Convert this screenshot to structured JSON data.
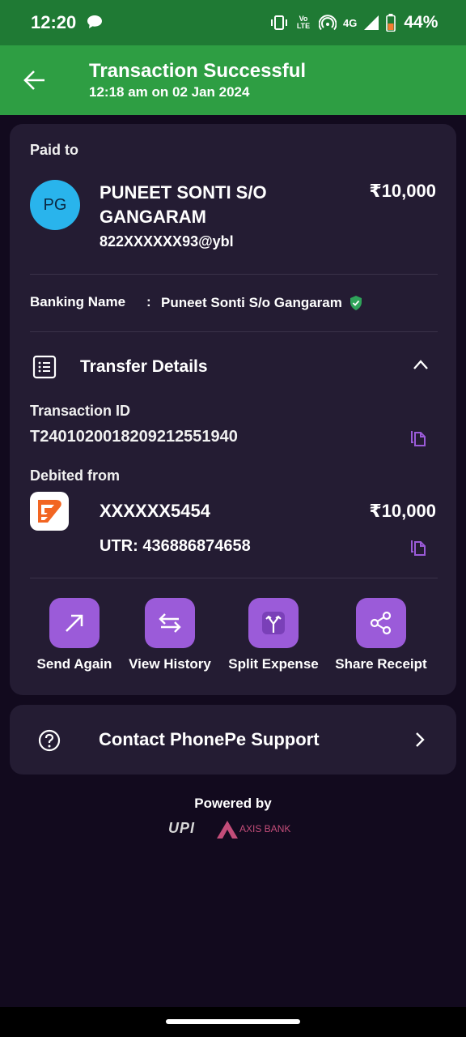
{
  "status_bar": {
    "time": "12:20",
    "network": "4G",
    "volte": "Vo LTE",
    "battery": "44%"
  },
  "header": {
    "title": "Transaction Successful",
    "subtitle": "12:18 am on 02 Jan 2024",
    "color": "#2e9e43"
  },
  "paid_to": {
    "label": "Paid to",
    "initials": "PG",
    "name": "PUNEET SONTI S/O GANGARAM",
    "amount": "₹10,000",
    "upi_id": "822XXXXXX93@ybl",
    "banking_name_label": "Banking Name",
    "banking_name_sep": ":",
    "banking_name": "Puneet Sonti S/o Gangaram"
  },
  "transfer_details": {
    "title": "Transfer Details",
    "transaction_id_label": "Transaction ID",
    "transaction_id": "T2401020018209212551940",
    "debited_from_label": "Debited from",
    "account": "XXXXXX5454",
    "amount": "₹10,000",
    "utr": "UTR: 436886874658"
  },
  "actions": [
    {
      "label": "Send Again",
      "icon": "arrow-up-right-icon"
    },
    {
      "label": "View History",
      "icon": "swap-arrows-icon"
    },
    {
      "label": "Split Expense",
      "icon": "split-icon"
    },
    {
      "label": "Share Receipt",
      "icon": "share-icon"
    }
  ],
  "support": {
    "label": "Contact PhonePe Support"
  },
  "footer": {
    "powered_by": "Powered by",
    "upi_logo": "UPI",
    "bank_logo": "AXIS BANK"
  },
  "colors": {
    "background": "#120a1e",
    "card": "#241c33",
    "accent_purple": "#9b5bd9",
    "status_green": "#1f7a34"
  }
}
